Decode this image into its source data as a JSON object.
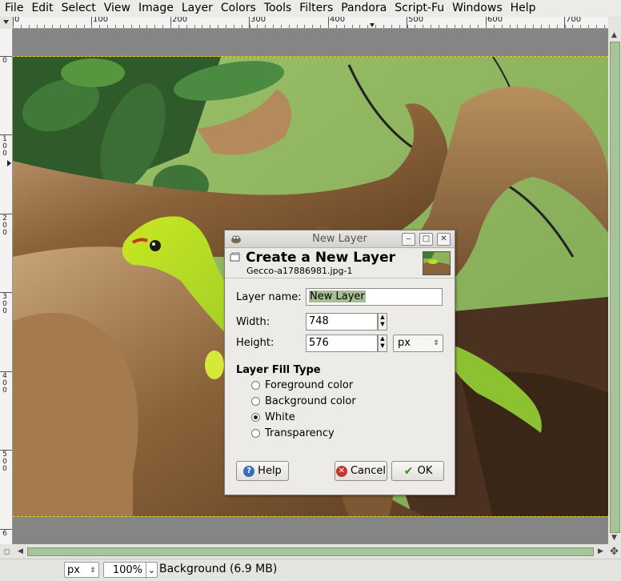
{
  "menubar": [
    "File",
    "Edit",
    "Select",
    "View",
    "Image",
    "Layer",
    "Colors",
    "Tools",
    "Filters",
    "Pandora",
    "Script-Fu",
    "Windows",
    "Help"
  ],
  "ruler": {
    "h_labels": [
      "0",
      "100",
      "200",
      "300",
      "400",
      "500",
      "600",
      "700"
    ],
    "v_labels": [
      "0",
      "100",
      "200",
      "300",
      "400",
      "500",
      "6"
    ]
  },
  "canvas": {
    "bg": "#858585",
    "selection_color": "#e8d200"
  },
  "statusbar": {
    "unit": "px",
    "zoom": "100%",
    "message": "Background (6.9 MB)"
  },
  "dialog": {
    "window_title": "New Layer",
    "heading": "Create a New Layer",
    "subheading": "Gecco-a17886981.jpg-1",
    "layer_name_label": "Layer name:",
    "layer_name_value": "New Layer",
    "width_label": "Width:",
    "width_value": "748",
    "height_label": "Height:",
    "height_value": "576",
    "unit_value": "px",
    "fill_type_heading": "Layer Fill Type",
    "fill_options": [
      {
        "label": "Foreground color",
        "selected": false
      },
      {
        "label": "Background color",
        "selected": false
      },
      {
        "label": "White",
        "selected": true
      },
      {
        "label": "Transparency",
        "selected": false
      }
    ],
    "help_label": "Help",
    "cancel_label": "Cancel",
    "ok_label": "OK"
  },
  "icons": [
    "gimp-wilber-icon",
    "minimize-icon",
    "maximize-icon",
    "close-icon",
    "new-layer-icon",
    "help-icon",
    "cancel-icon",
    "ok-check-icon",
    "navigate-icon",
    "quick-mask-icon"
  ],
  "colors": {
    "scroll_thumb": "#a6c39a",
    "wall_green": "#8db35a",
    "gecko_green": "#b8de2a"
  }
}
